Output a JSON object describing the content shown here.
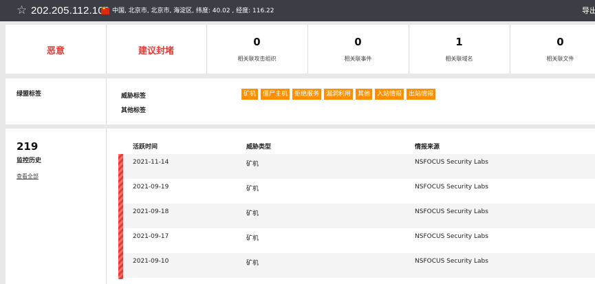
{
  "header": {
    "ip": "202.205.112.100",
    "location": "中国, 北京市, 北京市, 海淀区, 纬度: 40.02 , 经度: 116.22",
    "export_label": "导出",
    "star_icon": "star-outline-icon",
    "flag_icon": "china-flag-icon"
  },
  "summary": {
    "verdict": "恶意",
    "advice": "建议封堵",
    "stats": [
      {
        "value": "0",
        "label": "相关联攻击组织"
      },
      {
        "value": "0",
        "label": "相关联事件"
      },
      {
        "value": "1",
        "label": "相关联域名"
      },
      {
        "value": "0",
        "label": "相关联文件"
      }
    ],
    "colors": {
      "danger": "#e53935",
      "tag": "#ff8f00"
    }
  },
  "tags": {
    "section_label": "绿盟标签",
    "threat_label": "威胁标签",
    "other_label": "其他标签",
    "threat_tags": [
      "矿机",
      "僵尸主机",
      "拒绝服务",
      "漏洞利用",
      "其他",
      "入站情报",
      "出站情报"
    ]
  },
  "history": {
    "count": "219",
    "label": "监控历史",
    "view_all": "查看全部",
    "columns": [
      "活跃时间",
      "威胁类型",
      "情报来源"
    ],
    "rows": [
      {
        "date": "2021-11-14",
        "type": "矿机",
        "source": "NSFOCUS Security Labs"
      },
      {
        "date": "2021-09-19",
        "type": "矿机",
        "source": "NSFOCUS Security Labs"
      },
      {
        "date": "2021-09-18",
        "type": "矿机",
        "source": "NSFOCUS Security Labs"
      },
      {
        "date": "2021-09-17",
        "type": "矿机",
        "source": "NSFOCUS Security Labs"
      },
      {
        "date": "2021-09-10",
        "type": "矿机",
        "source": "NSFOCUS Security Labs"
      }
    ]
  }
}
